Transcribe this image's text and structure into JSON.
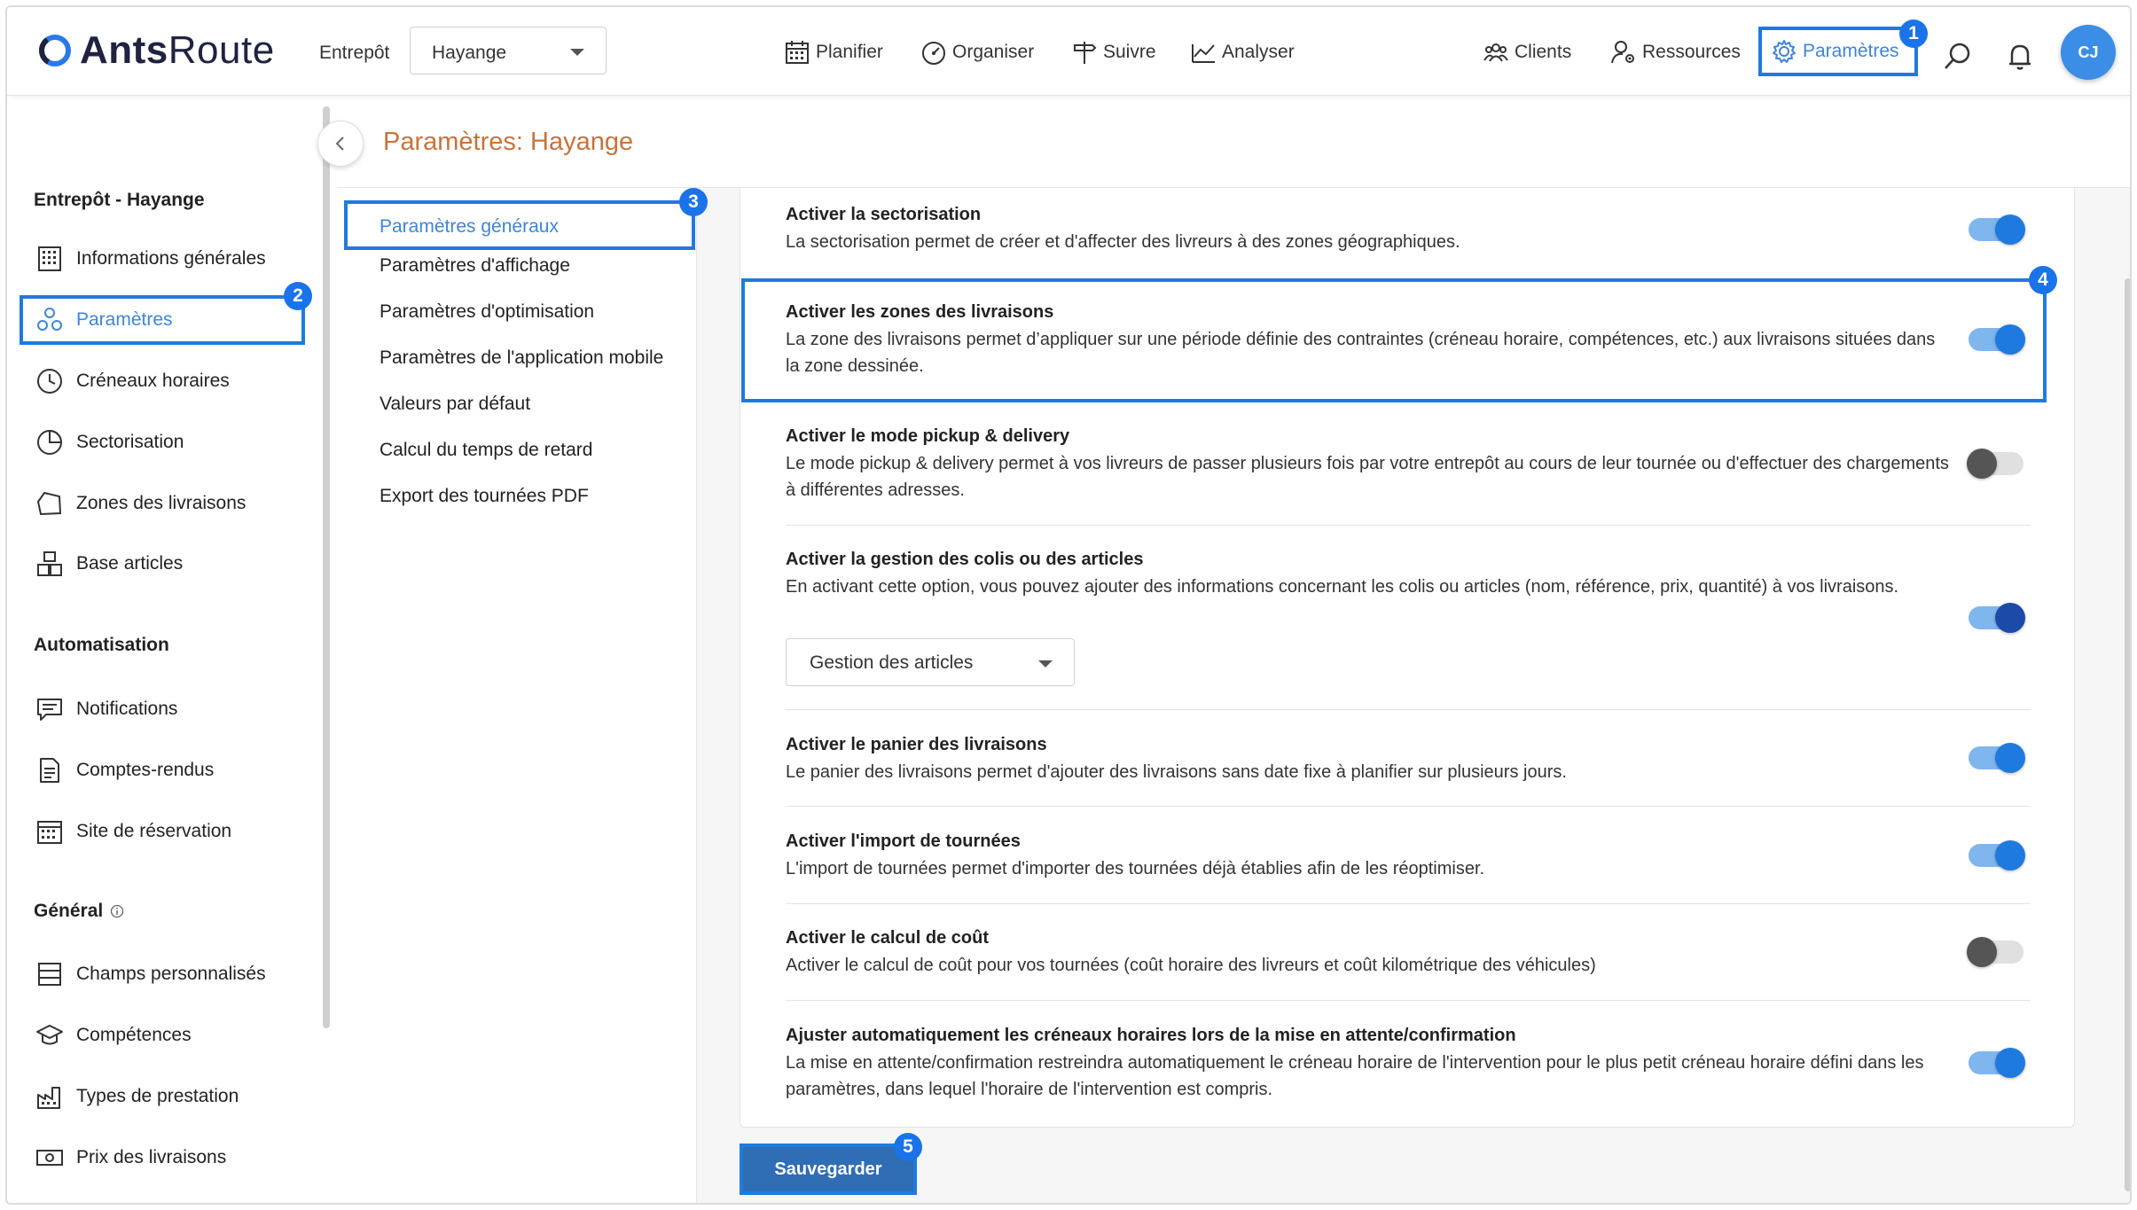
{
  "app": {
    "logo_text_bold": "Ants",
    "logo_text_light": "Route"
  },
  "header": {
    "entrepot_label": "Entrepôt",
    "entrepot_value": "Hayange",
    "nav": {
      "planifier": "Planifier",
      "organiser": "Organiser",
      "suivre": "Suivre",
      "analyser": "Analyser",
      "clients": "Clients",
      "ressources": "Ressources",
      "parametres": "Paramètres"
    },
    "avatar_initials": "CJ"
  },
  "badges": [
    "1",
    "2",
    "3",
    "4",
    "5"
  ],
  "sidebar": {
    "section1": "Entrepôt - Hayange",
    "items1": [
      "Informations générales",
      "Paramètres",
      "Créneaux horaires",
      "Sectorisation",
      "Zones des livraisons",
      "Base articles"
    ],
    "section2": "Automatisation",
    "items2": [
      "Notifications",
      "Comptes-rendus",
      "Site de réservation"
    ],
    "section3": "Général",
    "items3": [
      "Champs personnalisés",
      "Compétences",
      "Types de prestation",
      "Prix des livraisons"
    ]
  },
  "page_title": "Paramètres: Hayange",
  "subnav": [
    "Paramètres généraux",
    "Paramètres d'affichage",
    "Paramètres d'optimisation",
    "Paramètres de l'application mobile",
    "Valeurs par défaut",
    "Calcul du temps de retard",
    "Export des tournées PDF"
  ],
  "settings": [
    {
      "title": "Activer la sectorisation",
      "desc": "La sectorisation permet de créer et d'affecter des livreurs à des zones géographiques.",
      "enabled": true
    },
    {
      "title": "Activer les zones des livraisons",
      "desc": "La zone des livraisons permet d’appliquer sur une période définie des contraintes (créneau horaire, compétences, etc.) aux livraisons situées dans la zone dessinée.",
      "enabled": true
    },
    {
      "title": "Activer le mode pickup & delivery",
      "desc": "Le mode pickup & delivery permet à vos livreurs de passer plusieurs fois par votre entrepôt au cours de leur tournée ou d'effectuer des chargements à différentes adresses.",
      "enabled": false
    },
    {
      "title": "Activer la gestion des colis ou des articles",
      "desc": "En activant cette option, vous pouvez ajouter des informations concernant les colis ou articles (nom, référence, prix, quantité) à vos livraisons.",
      "enabled": true,
      "select_value": "Gestion des articles"
    },
    {
      "title": "Activer le panier des livraisons",
      "desc": "Le panier des livraisons permet d'ajouter des livraisons sans date fixe à planifier sur plusieurs jours.",
      "enabled": true
    },
    {
      "title": "Activer l'import de tournées",
      "desc": "L'import de tournées permet d'importer des tournées déjà établies afin de les réoptimiser.",
      "enabled": true
    },
    {
      "title": "Activer le calcul de coût",
      "desc": "Activer le calcul de coût pour vos tournées (coût horaire des livreurs et coût kilométrique des véhicules)",
      "enabled": false
    },
    {
      "title": "Ajuster automatiquement les créneaux horaires lors de la mise en attente/confirmation",
      "desc": "La mise en attente/confirmation restreindra automatiquement le créneau horaire de l'intervention pour le plus petit créneau horaire défini dans les paramètres, dans lequel l'horaire de l'intervention est compris.",
      "enabled": true
    }
  ],
  "save_label": "Sauvegarder",
  "colors": {
    "accent": "#1f7ae0",
    "title_orange": "#c7733c",
    "save_bg": "#2f6db5"
  }
}
